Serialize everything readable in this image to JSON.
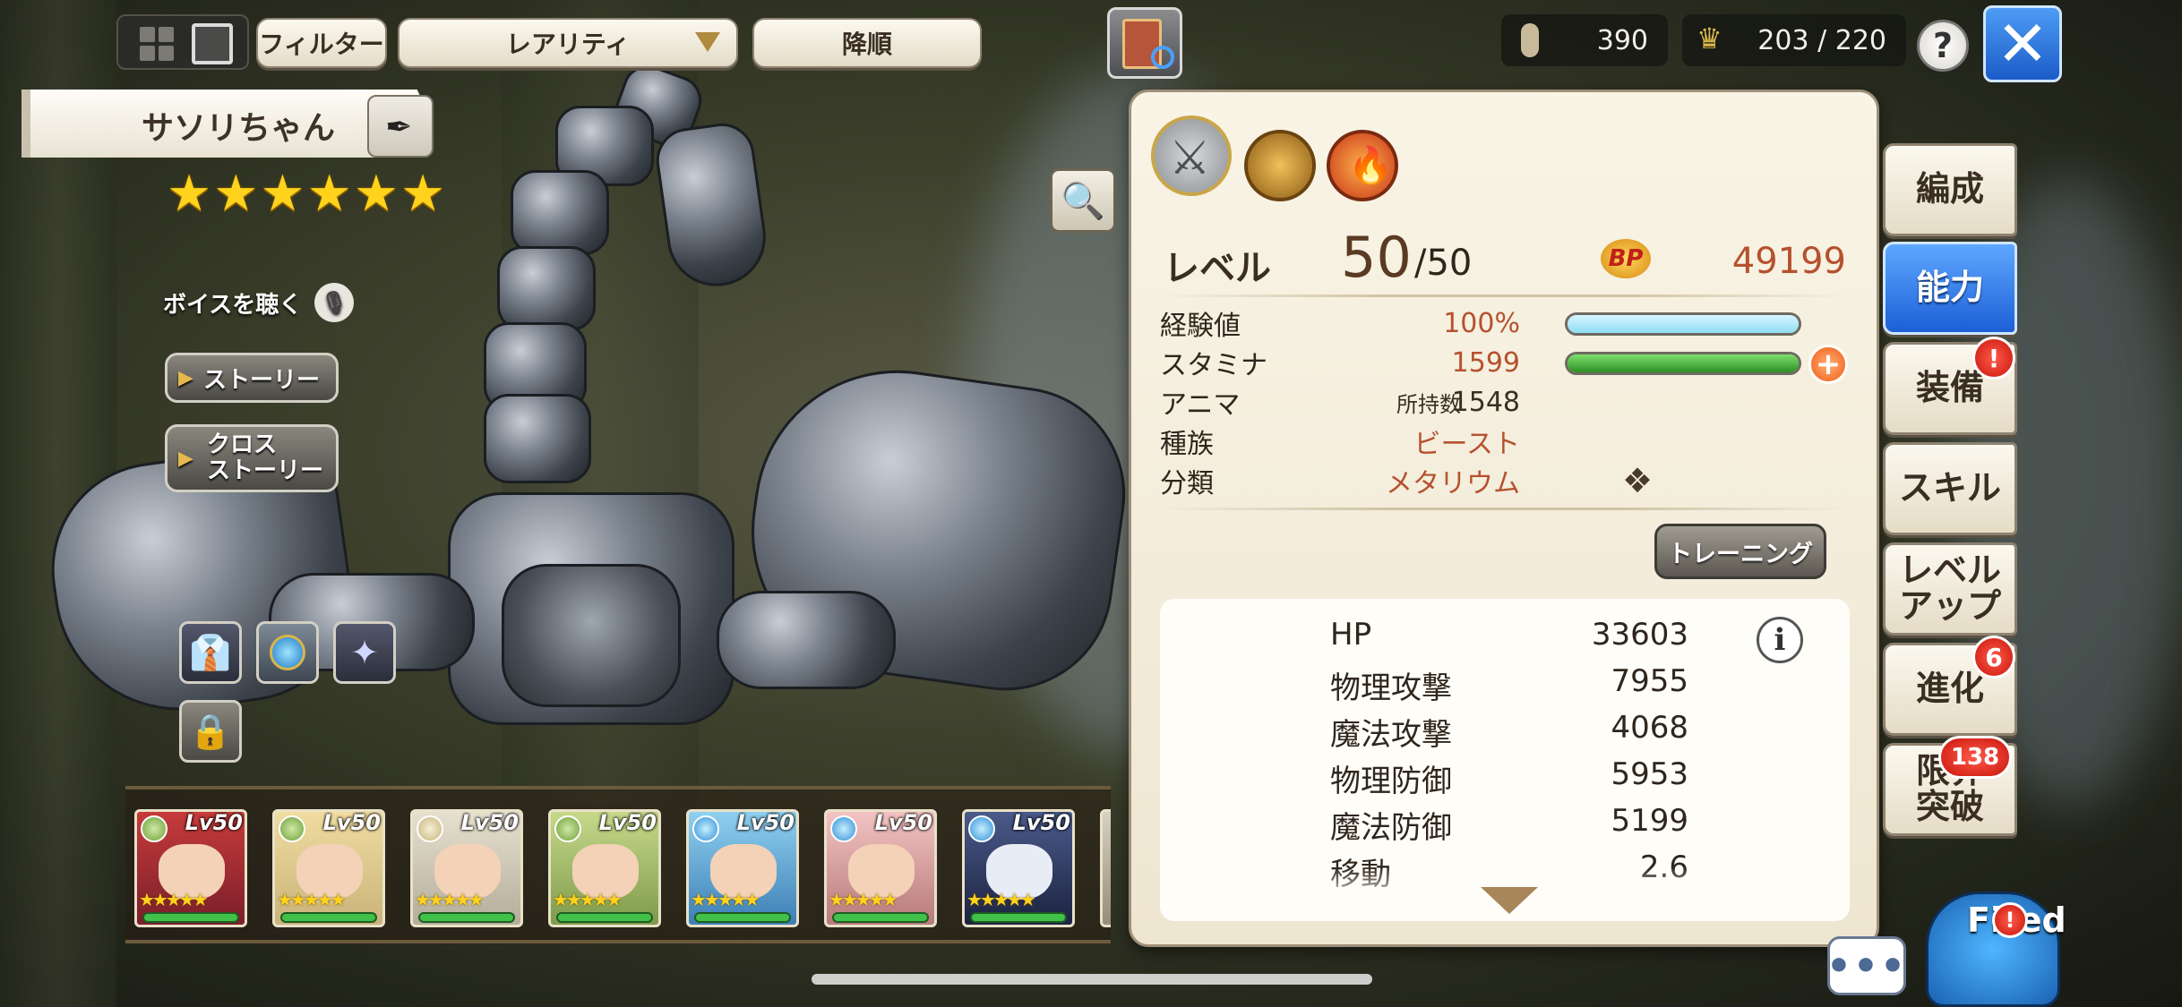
{
  "header": {
    "filter_label": "フィルター",
    "sort_select_value": "レアリティ",
    "order_label": "降順",
    "currency_1": "390",
    "capacity": "203 / 220",
    "help_label": "?",
    "close_label": "✕"
  },
  "character": {
    "name": "サソリちゃん",
    "stars": "★★★★★★",
    "voice_label": "ボイスを聴く",
    "story_label": "ストーリー",
    "cross_story_label_1": "クロス",
    "cross_story_label_2": "ストーリー"
  },
  "panel": {
    "level_label": "レベル",
    "level_value": "50",
    "level_max": "/50",
    "bp_label": "BP",
    "bp_value": "49199",
    "rows": [
      {
        "label": "経験値",
        "value": "100%"
      },
      {
        "label": "スタミナ",
        "value": "1599"
      },
      {
        "label": "アニマ",
        "sub": "所持数",
        "value": "1548"
      },
      {
        "label": "種族",
        "value": "ビースト"
      },
      {
        "label": "分類",
        "value": "メタリウム"
      }
    ],
    "exp_fill": 1.0,
    "stamina_fill": 1.0,
    "training_label": "トレーニング",
    "stats": [
      {
        "label": "HP",
        "value": "33603"
      },
      {
        "label": "物理攻撃",
        "value": "7955"
      },
      {
        "label": "魔法攻撃",
        "value": "4068"
      },
      {
        "label": "物理防御",
        "value": "5953"
      },
      {
        "label": "魔法防御",
        "value": "5199"
      },
      {
        "label": "移動",
        "value": "2.6"
      }
    ]
  },
  "tabs": [
    {
      "label": "編成"
    },
    {
      "label": "能力"
    },
    {
      "label": "装備",
      "notif": "!"
    },
    {
      "label": "スキル"
    },
    {
      "label_1": "レベル",
      "label_2": "アップ"
    },
    {
      "label": "進化",
      "notif": "6"
    },
    {
      "label_1": "限界",
      "label_2": "突破",
      "notif": "138"
    }
  ],
  "party": [
    {
      "level": "Lv50",
      "stars": "★★★★★"
    },
    {
      "level": "Lv50",
      "stars": "★★★★★"
    },
    {
      "level": "Lv50",
      "stars": "★★★★★"
    },
    {
      "level": "Lv50",
      "stars": "★★★★★"
    },
    {
      "level": "Lv50",
      "stars": "★★★★★"
    },
    {
      "level": "Lv50",
      "stars": "★★★★★"
    },
    {
      "level": "Lv50",
      "stars": "★★★★★"
    }
  ],
  "footer": {
    "chat_label": "•••",
    "fired_label": "Fired"
  },
  "colors": {
    "active_tab": "#2f78e8",
    "stamina_bar": "#3fb03a",
    "exp_bar": "#a9e6f5",
    "value_text": "#b6512e"
  }
}
